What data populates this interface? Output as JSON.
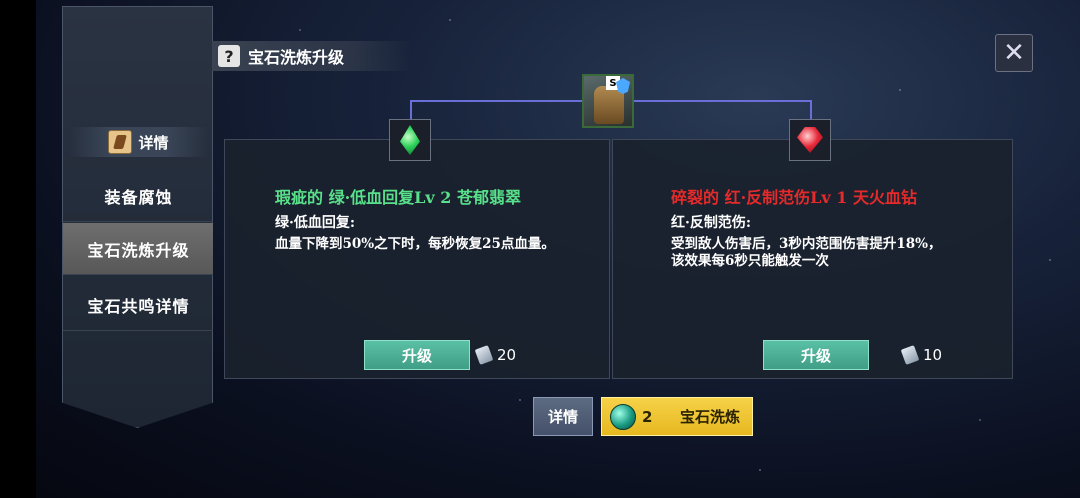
{
  "header": {
    "title": "宝石洗炼升级",
    "help_icon": "?",
    "close_icon": "✕"
  },
  "sidebar": {
    "header_label": "详情",
    "items": [
      {
        "label": "装备腐蚀",
        "active": false
      },
      {
        "label": "宝石洗炼升级",
        "active": true
      },
      {
        "label": "宝石共鸣详情",
        "active": false
      }
    ]
  },
  "equipment": {
    "badge": "S"
  },
  "gems": [
    {
      "color": "#58e08a",
      "name": "瑕疵的 绿·低血回复Lv 2 苍郁翡翠",
      "effect_title": "绿·低血回复:",
      "description": "血量下降到50%之下时，每秒恢复25点血量。",
      "upgrade_label": "升级",
      "cost": "20"
    },
    {
      "color": "#e62a2a",
      "name": "碎裂的 红·反制范伤Lv 1 天火血钻",
      "effect_title": "红·反制范伤:",
      "description": "受到敌人伤害后，3秒内范围伤害提升18%，该效果每6秒只能触发一次",
      "upgrade_label": "升级",
      "cost": "10"
    }
  ],
  "footer": {
    "detail_label": "详情",
    "refine_count": "2",
    "refine_label": "宝石洗炼"
  }
}
